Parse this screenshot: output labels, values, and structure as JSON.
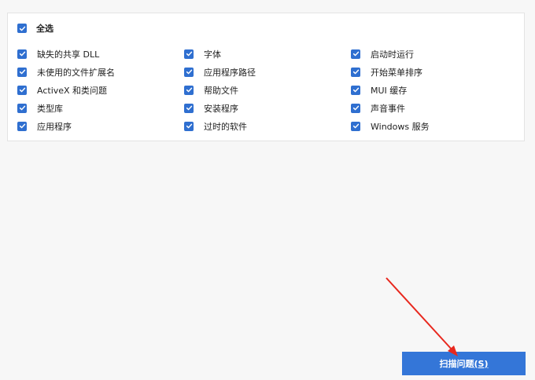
{
  "select_all": {
    "label": "全选",
    "checked": true
  },
  "options": [
    {
      "label": "缺失的共享 DLL",
      "checked": true
    },
    {
      "label": "未使用的文件扩展名",
      "checked": true
    },
    {
      "label": "ActiveX 和类问题",
      "checked": true
    },
    {
      "label": "类型库",
      "checked": true
    },
    {
      "label": "应用程序",
      "checked": true
    },
    {
      "label": "字体",
      "checked": true
    },
    {
      "label": "应用程序路径",
      "checked": true
    },
    {
      "label": "帮助文件",
      "checked": true
    },
    {
      "label": "安装程序",
      "checked": true
    },
    {
      "label": "过时的软件",
      "checked": true
    },
    {
      "label": "启动时运行",
      "checked": true
    },
    {
      "label": "开始菜单排序",
      "checked": true
    },
    {
      "label": "MUI 缓存",
      "checked": true
    },
    {
      "label": "声音事件",
      "checked": true
    },
    {
      "label": "Windows 服务",
      "checked": true
    }
  ],
  "scan_button": {
    "label": "扫描问题",
    "hotkey": "(S)"
  },
  "colors": {
    "accent": "#3476d8",
    "checkbox": "#2f6fd0",
    "annotation_arrow": "#e8281e"
  }
}
